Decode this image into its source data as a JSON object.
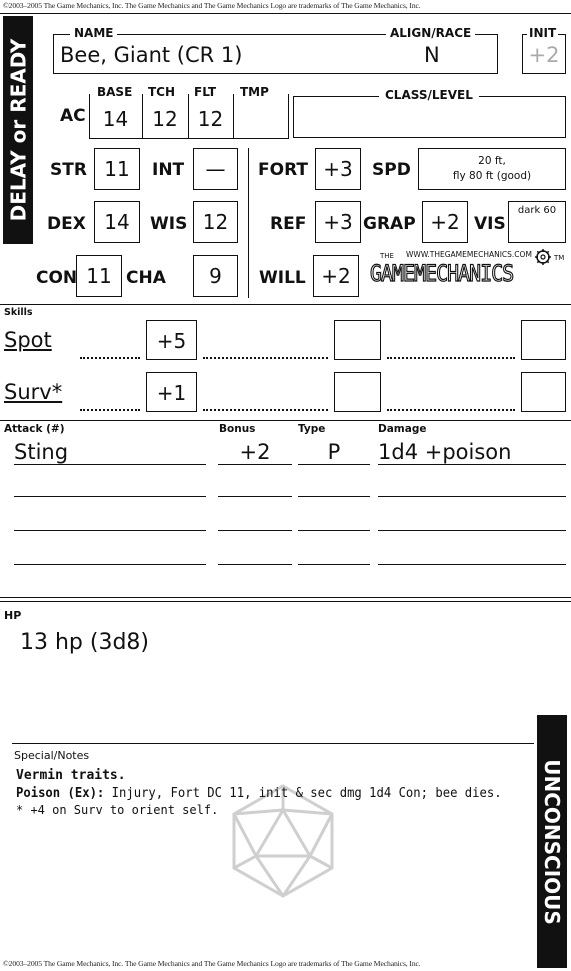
{
  "copyright": "©2003–2005 The Game Mechanics, Inc. The Game Mechanics and The Game Mechanics Logo are trademarks of The Game Mechanics, Inc.",
  "side_bars": {
    "left": "DELAY or READY",
    "right": "UNCONSCIOUS"
  },
  "header": {
    "name_label": "NAME",
    "name_value": "Bee, Giant (CR 1)",
    "align_label": "ALIGN/RACE",
    "align_value": "N",
    "init_label": "INIT",
    "init_value": "+2"
  },
  "ac": {
    "label": "AC",
    "base_label": "BASE",
    "base": "14",
    "tch_label": "TCH",
    "tch": "12",
    "flt_label": "FLT",
    "flt": "12",
    "tmp_label": "TMP",
    "tmp": ""
  },
  "class_level_label": "CLASS/LEVEL",
  "abilities": {
    "str_label": "STR",
    "str": "11",
    "dex_label": "DEX",
    "dex": "14",
    "con_label": "CON",
    "con": "11",
    "int_label": "INT",
    "int": "—",
    "wis_label": "WIS",
    "wis": "12",
    "cha_label": "CHA",
    "cha": "9"
  },
  "saves": {
    "fort_label": "FORT",
    "fort": "+3",
    "ref_label": "REF",
    "ref": "+3",
    "will_label": "WILL",
    "will": "+2"
  },
  "speed": {
    "label": "SPD",
    "line1": "20 ft,",
    "line2": "fly 80 ft (good)"
  },
  "grapple": {
    "label": "GRAP",
    "value": "+2"
  },
  "vision": {
    "label": "VIS",
    "value": "dark 60"
  },
  "logo": {
    "url": "WWW.THEGAMEMECHANICS.COM",
    "the": "THE",
    "name": "GAMEMECHANICS",
    "tm": "TM"
  },
  "skills": {
    "label": "Skills",
    "rows": [
      {
        "name": "Spot",
        "bonus": "+5"
      },
      {
        "name": "Surv*",
        "bonus": "+1"
      }
    ]
  },
  "attacks": {
    "label": "Attack (#)",
    "bonus_label": "Bonus",
    "type_label": "Type",
    "damage_label": "Damage",
    "rows": [
      {
        "name": "Sting",
        "bonus": "+2",
        "type": "P",
        "damage": "1d4 +poison"
      }
    ]
  },
  "hp": {
    "label": "HP",
    "value": "13 hp (3d8)"
  },
  "notes": {
    "label": "Special/Notes",
    "line1": "Vermin traits.",
    "line2_bold": "Poison (Ex):",
    "line2_rest": " Injury, Fort DC 11, init & sec dmg 1d4 Con; bee dies.",
    "line3": "* +4 on Surv to orient self."
  }
}
